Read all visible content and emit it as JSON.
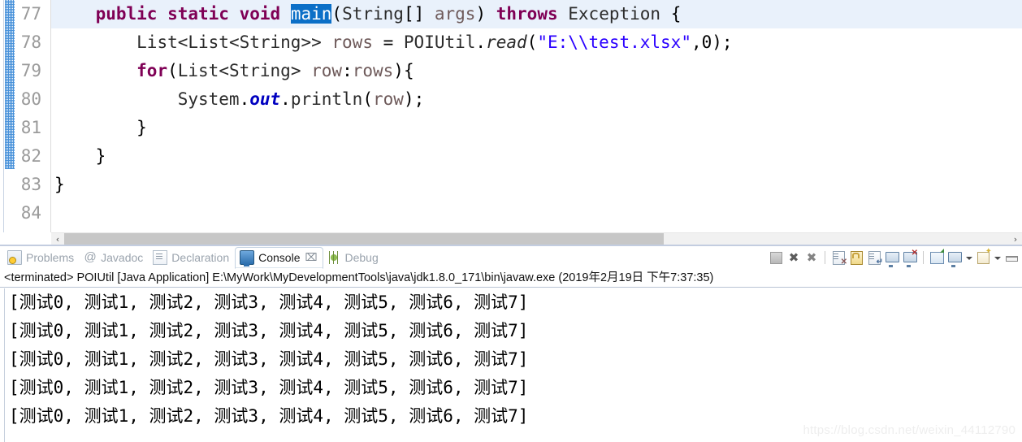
{
  "editor": {
    "current_line_number": 77,
    "selection_text": "main",
    "selection_bg": "#0b6fc7",
    "lines": [
      {
        "number": "77",
        "fold": true,
        "current": true,
        "indent": 0,
        "tokens": [
          {
            "t": "    ",
            "c": "plain"
          },
          {
            "t": "public",
            "c": "kw"
          },
          {
            "t": " ",
            "c": "plain"
          },
          {
            "t": "static",
            "c": "kw"
          },
          {
            "t": " ",
            "c": "plain"
          },
          {
            "t": "void",
            "c": "kw"
          },
          {
            "t": " ",
            "c": "plain"
          },
          {
            "t": "main",
            "c": "sel"
          },
          {
            "t": "(",
            "c": "punc"
          },
          {
            "t": "String",
            "c": "type"
          },
          {
            "t": "[] ",
            "c": "punc"
          },
          {
            "t": "args",
            "c": "ident"
          },
          {
            "t": ") ",
            "c": "punc"
          },
          {
            "t": "throws",
            "c": "kw"
          },
          {
            "t": " ",
            "c": "plain"
          },
          {
            "t": "Exception",
            "c": "type"
          },
          {
            "t": " {",
            "c": "punc"
          }
        ]
      },
      {
        "number": "78",
        "fold": false,
        "current": false,
        "tokens": [
          {
            "t": "        ",
            "c": "plain"
          },
          {
            "t": "List<List<String>>",
            "c": "type"
          },
          {
            "t": " ",
            "c": "plain"
          },
          {
            "t": "rows",
            "c": "ident"
          },
          {
            "t": " = ",
            "c": "punc"
          },
          {
            "t": "POIUtil",
            "c": "type"
          },
          {
            "t": ".",
            "c": "punc"
          },
          {
            "t": "read",
            "c": "method"
          },
          {
            "t": "(",
            "c": "punc"
          },
          {
            "t": "\"E:\\\\test.xlsx\"",
            "c": "str"
          },
          {
            "t": ",",
            "c": "punc"
          },
          {
            "t": "0",
            "c": "num"
          },
          {
            "t": ");",
            "c": "punc"
          }
        ]
      },
      {
        "number": "79",
        "fold": false,
        "current": false,
        "tokens": [
          {
            "t": "        ",
            "c": "plain"
          },
          {
            "t": "for",
            "c": "kw"
          },
          {
            "t": "(",
            "c": "punc"
          },
          {
            "t": "List<String>",
            "c": "type"
          },
          {
            "t": " ",
            "c": "plain"
          },
          {
            "t": "row",
            "c": "ident"
          },
          {
            "t": ":",
            "c": "punc"
          },
          {
            "t": "rows",
            "c": "ident"
          },
          {
            "t": "){",
            "c": "punc"
          }
        ]
      },
      {
        "number": "80",
        "fold": false,
        "current": false,
        "tokens": [
          {
            "t": "            ",
            "c": "plain"
          },
          {
            "t": "System",
            "c": "type"
          },
          {
            "t": ".",
            "c": "punc"
          },
          {
            "t": "out",
            "c": "field"
          },
          {
            "t": ".",
            "c": "punc"
          },
          {
            "t": "println",
            "c": "type"
          },
          {
            "t": "(",
            "c": "punc"
          },
          {
            "t": "row",
            "c": "ident"
          },
          {
            "t": ");",
            "c": "punc"
          }
        ]
      },
      {
        "number": "81",
        "fold": false,
        "current": false,
        "tokens": [
          {
            "t": "        }",
            "c": "punc"
          }
        ]
      },
      {
        "number": "82",
        "fold": false,
        "current": false,
        "tokens": [
          {
            "t": "    }",
            "c": "punc"
          }
        ]
      },
      {
        "number": "83",
        "fold": false,
        "current": false,
        "tokens": [
          {
            "t": "}",
            "c": "punc"
          }
        ]
      },
      {
        "number": "84",
        "fold": false,
        "current": false,
        "tokens": []
      }
    ],
    "hscroll": {
      "left_arrow": "‹",
      "right_arrow": "›"
    }
  },
  "console": {
    "tabs": [
      {
        "label": "Problems",
        "icon": "problems-icon",
        "active": false,
        "closeable": false
      },
      {
        "label": "Javadoc",
        "icon": "at-icon",
        "active": false,
        "closeable": false
      },
      {
        "label": "Declaration",
        "icon": "declaration-icon",
        "active": false,
        "closeable": false
      },
      {
        "label": "Console",
        "icon": "console-icon",
        "active": true,
        "closeable": true,
        "close_glyph": "⌧"
      },
      {
        "label": "Debug",
        "icon": "debug-icon",
        "active": false,
        "closeable": false
      }
    ],
    "toolbar_icons": [
      {
        "name": "terminate-button",
        "kind": "stop"
      },
      {
        "name": "remove-launch-button",
        "kind": "x"
      },
      {
        "name": "remove-all-terminated-button",
        "kind": "xx"
      },
      {
        "name": "separator-1",
        "kind": "sep"
      },
      {
        "name": "clear-console-button",
        "kind": "doc-x"
      },
      {
        "name": "scroll-lock-button",
        "kind": "lock"
      },
      {
        "name": "word-wrap-button",
        "kind": "doc-wrap"
      },
      {
        "name": "show-console-when-output-button",
        "kind": "screen"
      },
      {
        "name": "show-console-when-error-button",
        "kind": "screen-x"
      },
      {
        "name": "separator-2",
        "kind": "sep"
      },
      {
        "name": "pin-console-button",
        "kind": "pin"
      },
      {
        "name": "display-selected-console-button",
        "kind": "screen"
      },
      {
        "name": "display-selected-console-dropdown",
        "kind": "caret"
      },
      {
        "name": "open-console-button",
        "kind": "new"
      },
      {
        "name": "open-console-dropdown",
        "kind": "caret"
      },
      {
        "name": "minimize-button",
        "kind": "min"
      }
    ],
    "process_line": "<terminated> POIUtil [Java Application] E:\\MyWork\\MyDevelopmentTools\\java\\jdk1.8.0_171\\bin\\javaw.exe (2019年2月19日 下午7:37:35)",
    "output_lines": [
      "[测试0, 测试1, 测试2, 测试3, 测试4, 测试5, 测试6, 测试7]",
      "[测试0, 测试1, 测试2, 测试3, 测试4, 测试5, 测试6, 测试7]",
      "[测试0, 测试1, 测试2, 测试3, 测试4, 测试5, 测试6, 测试7]",
      "[测试0, 测试1, 测试2, 测试3, 测试4, 测试5, 测试6, 测试7]",
      "[测试0, 测试1, 测试2, 测试3, 测试4, 测试5, 测试6, 测试7]"
    ]
  },
  "watermark": "https://blog.csdn.net/weixin_44112790"
}
